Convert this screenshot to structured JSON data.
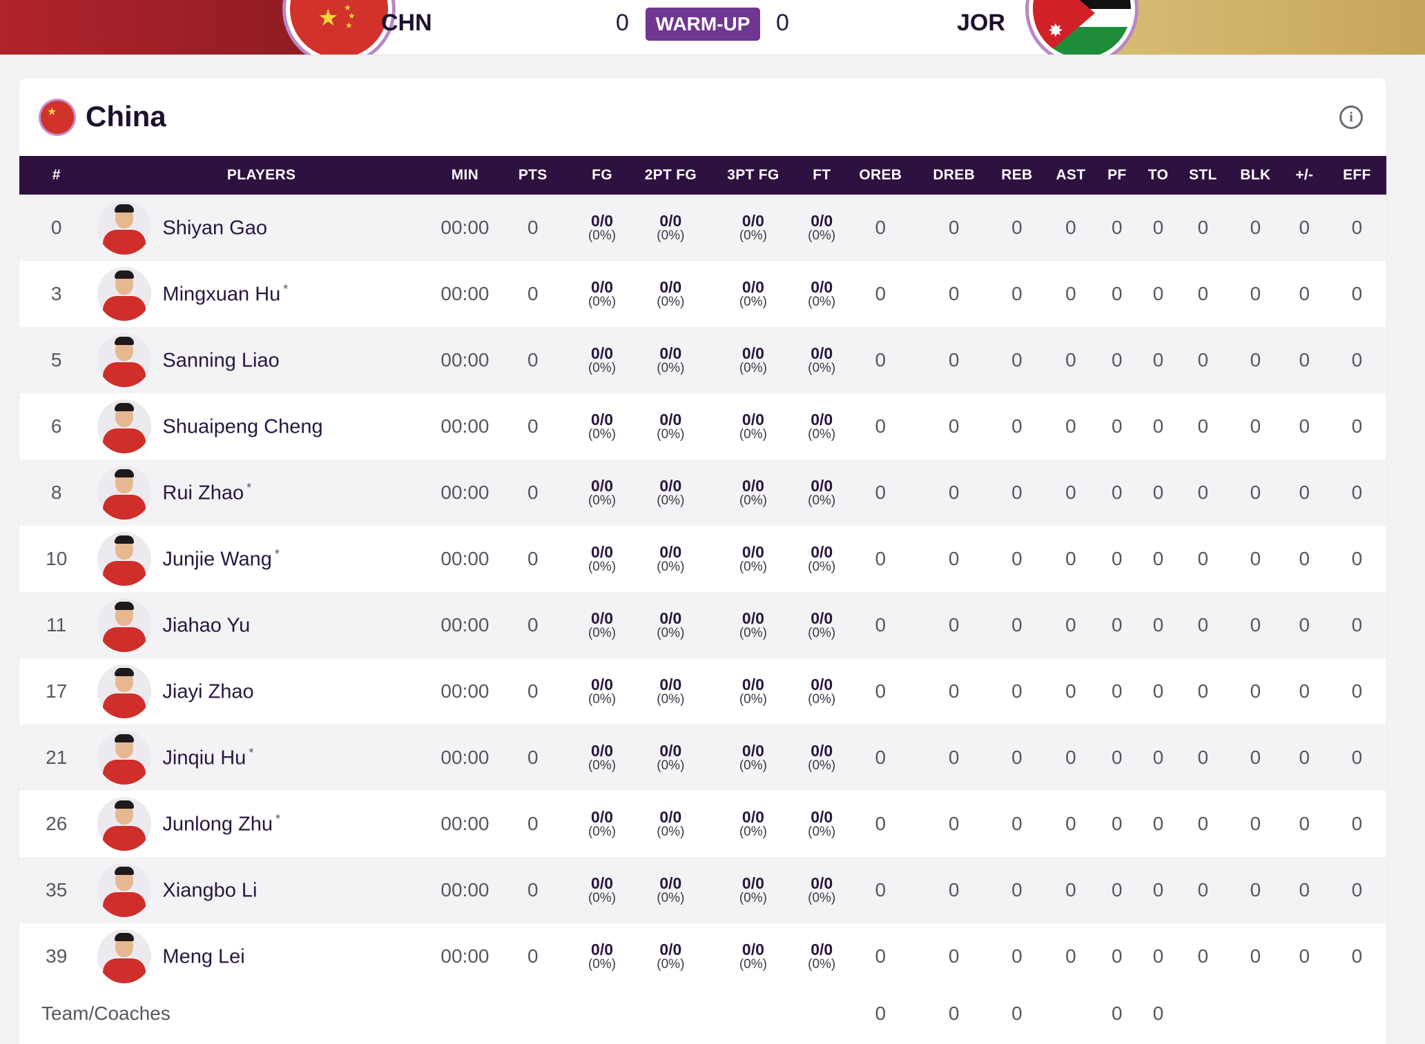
{
  "scoreboard": {
    "home_code": "CHN",
    "away_code": "JOR",
    "home_score": "0",
    "away_score": "0",
    "status": "WARM-UP"
  },
  "team": {
    "name": "China"
  },
  "columns": [
    "#",
    "PLAYERS",
    "MIN",
    "PTS",
    "FG",
    "2PT FG",
    "3PT FG",
    "FT",
    "OREB",
    "DREB",
    "REB",
    "AST",
    "PF",
    "TO",
    "STL",
    "BLK",
    "+/-",
    "EFF"
  ],
  "players": [
    {
      "no": "0",
      "name": "Shiyan Gao",
      "starter": "",
      "min": "00:00",
      "pts": "0",
      "fg": "0/0",
      "fg_pct": "(0%)",
      "fg2": "0/0",
      "fg2_pct": "(0%)",
      "fg3": "0/0",
      "fg3_pct": "(0%)",
      "ft": "0/0",
      "ft_pct": "(0%)",
      "oreb": "0",
      "dreb": "0",
      "reb": "0",
      "ast": "0",
      "pf": "0",
      "to": "0",
      "stl": "0",
      "blk": "0",
      "pm": "0",
      "eff": "0"
    },
    {
      "no": "3",
      "name": "Mingxuan Hu",
      "starter": "*",
      "min": "00:00",
      "pts": "0",
      "fg": "0/0",
      "fg_pct": "(0%)",
      "fg2": "0/0",
      "fg2_pct": "(0%)",
      "fg3": "0/0",
      "fg3_pct": "(0%)",
      "ft": "0/0",
      "ft_pct": "(0%)",
      "oreb": "0",
      "dreb": "0",
      "reb": "0",
      "ast": "0",
      "pf": "0",
      "to": "0",
      "stl": "0",
      "blk": "0",
      "pm": "0",
      "eff": "0"
    },
    {
      "no": "5",
      "name": "Sanning Liao",
      "starter": "",
      "min": "00:00",
      "pts": "0",
      "fg": "0/0",
      "fg_pct": "(0%)",
      "fg2": "0/0",
      "fg2_pct": "(0%)",
      "fg3": "0/0",
      "fg3_pct": "(0%)",
      "ft": "0/0",
      "ft_pct": "(0%)",
      "oreb": "0",
      "dreb": "0",
      "reb": "0",
      "ast": "0",
      "pf": "0",
      "to": "0",
      "stl": "0",
      "blk": "0",
      "pm": "0",
      "eff": "0"
    },
    {
      "no": "6",
      "name": "Shuaipeng Cheng",
      "starter": "",
      "min": "00:00",
      "pts": "0",
      "fg": "0/0",
      "fg_pct": "(0%)",
      "fg2": "0/0",
      "fg2_pct": "(0%)",
      "fg3": "0/0",
      "fg3_pct": "(0%)",
      "ft": "0/0",
      "ft_pct": "(0%)",
      "oreb": "0",
      "dreb": "0",
      "reb": "0",
      "ast": "0",
      "pf": "0",
      "to": "0",
      "stl": "0",
      "blk": "0",
      "pm": "0",
      "eff": "0"
    },
    {
      "no": "8",
      "name": "Rui Zhao",
      "starter": "*",
      "min": "00:00",
      "pts": "0",
      "fg": "0/0",
      "fg_pct": "(0%)",
      "fg2": "0/0",
      "fg2_pct": "(0%)",
      "fg3": "0/0",
      "fg3_pct": "(0%)",
      "ft": "0/0",
      "ft_pct": "(0%)",
      "oreb": "0",
      "dreb": "0",
      "reb": "0",
      "ast": "0",
      "pf": "0",
      "to": "0",
      "stl": "0",
      "blk": "0",
      "pm": "0",
      "eff": "0"
    },
    {
      "no": "10",
      "name": "Junjie Wang",
      "starter": "*",
      "min": "00:00",
      "pts": "0",
      "fg": "0/0",
      "fg_pct": "(0%)",
      "fg2": "0/0",
      "fg2_pct": "(0%)",
      "fg3": "0/0",
      "fg3_pct": "(0%)",
      "ft": "0/0",
      "ft_pct": "(0%)",
      "oreb": "0",
      "dreb": "0",
      "reb": "0",
      "ast": "0",
      "pf": "0",
      "to": "0",
      "stl": "0",
      "blk": "0",
      "pm": "0",
      "eff": "0"
    },
    {
      "no": "11",
      "name": "Jiahao Yu",
      "starter": "",
      "min": "00:00",
      "pts": "0",
      "fg": "0/0",
      "fg_pct": "(0%)",
      "fg2": "0/0",
      "fg2_pct": "(0%)",
      "fg3": "0/0",
      "fg3_pct": "(0%)",
      "ft": "0/0",
      "ft_pct": "(0%)",
      "oreb": "0",
      "dreb": "0",
      "reb": "0",
      "ast": "0",
      "pf": "0",
      "to": "0",
      "stl": "0",
      "blk": "0",
      "pm": "0",
      "eff": "0"
    },
    {
      "no": "17",
      "name": "Jiayi Zhao",
      "starter": "",
      "min": "00:00",
      "pts": "0",
      "fg": "0/0",
      "fg_pct": "(0%)",
      "fg2": "0/0",
      "fg2_pct": "(0%)",
      "fg3": "0/0",
      "fg3_pct": "(0%)",
      "ft": "0/0",
      "ft_pct": "(0%)",
      "oreb": "0",
      "dreb": "0",
      "reb": "0",
      "ast": "0",
      "pf": "0",
      "to": "0",
      "stl": "0",
      "blk": "0",
      "pm": "0",
      "eff": "0"
    },
    {
      "no": "21",
      "name": "Jinqiu Hu",
      "starter": "*",
      "min": "00:00",
      "pts": "0",
      "fg": "0/0",
      "fg_pct": "(0%)",
      "fg2": "0/0",
      "fg2_pct": "(0%)",
      "fg3": "0/0",
      "fg3_pct": "(0%)",
      "ft": "0/0",
      "ft_pct": "(0%)",
      "oreb": "0",
      "dreb": "0",
      "reb": "0",
      "ast": "0",
      "pf": "0",
      "to": "0",
      "stl": "0",
      "blk": "0",
      "pm": "0",
      "eff": "0"
    },
    {
      "no": "26",
      "name": "Junlong Zhu",
      "starter": "*",
      "min": "00:00",
      "pts": "0",
      "fg": "0/0",
      "fg_pct": "(0%)",
      "fg2": "0/0",
      "fg2_pct": "(0%)",
      "fg3": "0/0",
      "fg3_pct": "(0%)",
      "ft": "0/0",
      "ft_pct": "(0%)",
      "oreb": "0",
      "dreb": "0",
      "reb": "0",
      "ast": "0",
      "pf": "0",
      "to": "0",
      "stl": "0",
      "blk": "0",
      "pm": "0",
      "eff": "0"
    },
    {
      "no": "35",
      "name": "Xiangbo Li",
      "starter": "",
      "min": "00:00",
      "pts": "0",
      "fg": "0/0",
      "fg_pct": "(0%)",
      "fg2": "0/0",
      "fg2_pct": "(0%)",
      "fg3": "0/0",
      "fg3_pct": "(0%)",
      "ft": "0/0",
      "ft_pct": "(0%)",
      "oreb": "0",
      "dreb": "0",
      "reb": "0",
      "ast": "0",
      "pf": "0",
      "to": "0",
      "stl": "0",
      "blk": "0",
      "pm": "0",
      "eff": "0"
    },
    {
      "no": "39",
      "name": "Meng Lei",
      "starter": "",
      "min": "00:00",
      "pts": "0",
      "fg": "0/0",
      "fg_pct": "(0%)",
      "fg2": "0/0",
      "fg2_pct": "(0%)",
      "fg3": "0/0",
      "fg3_pct": "(0%)",
      "ft": "0/0",
      "ft_pct": "(0%)",
      "oreb": "0",
      "dreb": "0",
      "reb": "0",
      "ast": "0",
      "pf": "0",
      "to": "0",
      "stl": "0",
      "blk": "0",
      "pm": "0",
      "eff": "0"
    }
  ],
  "team_row": {
    "label": "Team/Coaches",
    "oreb": "0",
    "dreb": "0",
    "reb": "0",
    "pf": "0",
    "to": "0"
  },
  "colors": {
    "header_bg": "#2e1141",
    "status_badge": "#6f3791",
    "china_red": "#d1322a",
    "gold_band": "#c4a55a"
  },
  "icons": [
    "info-icon",
    "china-flag-icon",
    "jordan-flag-icon"
  ]
}
